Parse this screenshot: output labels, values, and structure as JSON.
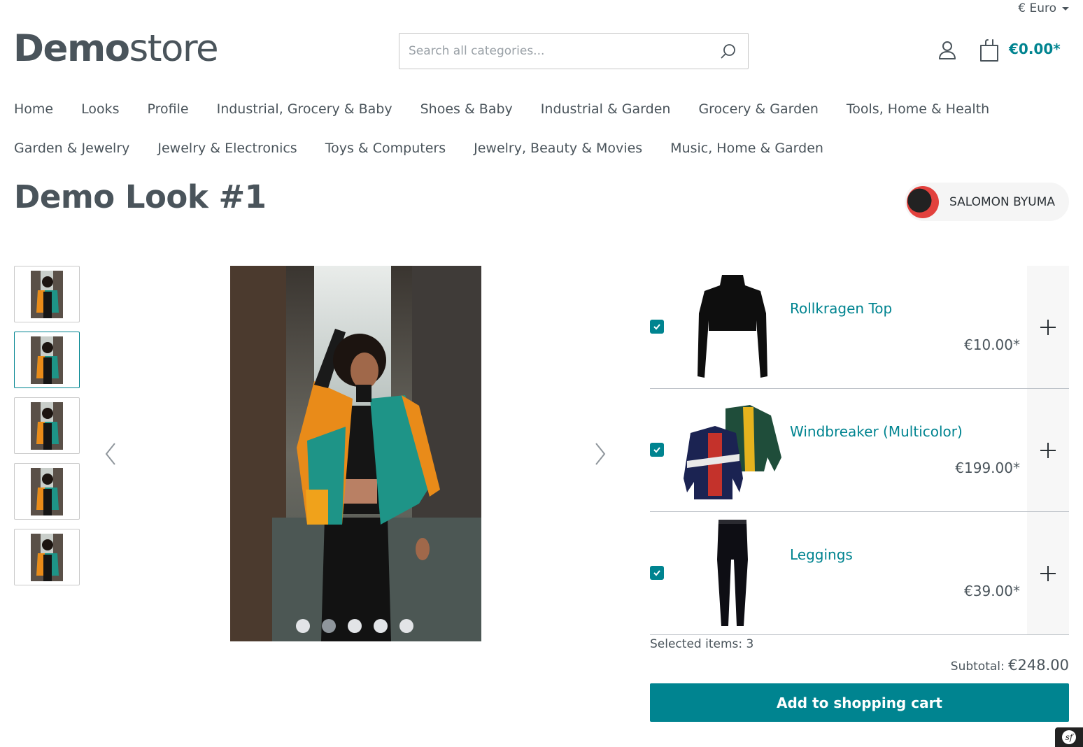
{
  "header": {
    "currency": "€ Euro",
    "logo_bold": "Demo",
    "logo_light": "store",
    "search_placeholder": "Search all categories...",
    "cart_total": "€0.00*"
  },
  "nav": {
    "row1": [
      "Home",
      "Looks",
      "Profile",
      "Industrial, Grocery & Baby",
      "Shoes & Baby",
      "Industrial & Garden",
      "Grocery & Garden",
      "Tools, Home & Health"
    ],
    "row2": [
      "Garden & Jewelry",
      "Jewelry & Electronics",
      "Toys & Computers",
      "Jewelry, Beauty & Movies",
      "Music, Home & Garden"
    ]
  },
  "look": {
    "title": "Demo Look #1",
    "author": "SALOMON BYUMA",
    "gallery_count": 5,
    "active_thumb": 2,
    "active_dot": 2
  },
  "products": [
    {
      "name": "Rollkragen Top",
      "price": "€10.00*",
      "checked": true
    },
    {
      "name": "Windbreaker (Multicolor)",
      "price": "€199.00*",
      "checked": true
    },
    {
      "name": "Leggings",
      "price": "€39.00*",
      "checked": true
    }
  ],
  "summary": {
    "selected_label": "Selected items: 3",
    "subtotal_label": "Subtotal:",
    "subtotal_value": "€248.00",
    "add_button": "Add to shopping cart"
  },
  "colors": {
    "accent": "#008490",
    "text": "#4a545b"
  }
}
